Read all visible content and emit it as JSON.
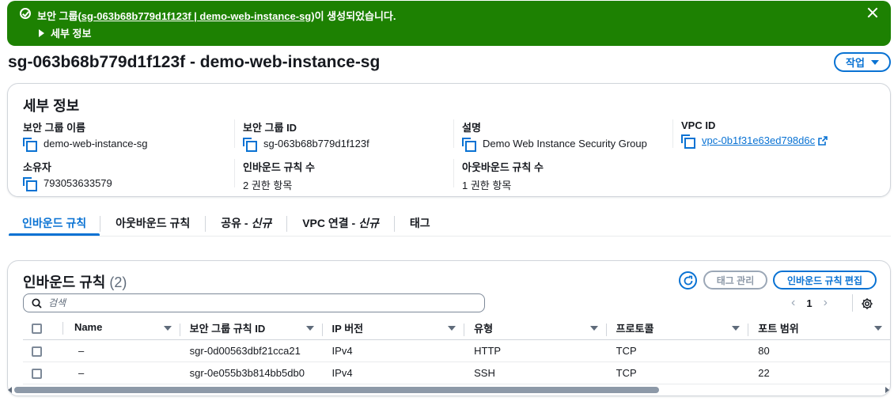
{
  "flash": {
    "message_prefix": "보안 그룹(",
    "message_link": "sg-063b68b779d1f123f | demo-web-instance-sg",
    "message_suffix": ")이 생성되었습니다.",
    "details_label": "세부 정보",
    "icon": "success-check-icon",
    "color": "#1d8102"
  },
  "page": {
    "title": "sg-063b68b779d1f123f - demo-web-instance-sg",
    "actions_label": "작업"
  },
  "details": {
    "title": "세부 정보",
    "fields": [
      {
        "label": "보안 그룹 이름",
        "value": "demo-web-instance-sg"
      },
      {
        "label": "보안 그룹 ID",
        "value": "sg-063b68b779d1f123f"
      },
      {
        "label": "설명",
        "value": "Demo Web Instance Security Group"
      },
      {
        "label": "VPC ID",
        "value": "vpc-0b1f31e63ed798d6c"
      },
      {
        "label": "소유자",
        "value": "793053633579"
      },
      {
        "label": "인바운드 규칙 수",
        "value": "2 권한 항목"
      },
      {
        "label": "아웃바운드 규칙 수",
        "value": "1 권한 항목"
      }
    ]
  },
  "tabs": [
    {
      "label": "인바운드 규칙",
      "new": ""
    },
    {
      "label": "아웃바운드 규칙",
      "new": ""
    },
    {
      "label": "공유 -",
      "new": "신규"
    },
    {
      "label": "VPC 연결 -",
      "new": "신규"
    },
    {
      "label": "태그",
      "new": ""
    }
  ],
  "rules": {
    "title": "인바운드 규칙",
    "count": "(2)",
    "manage_tags_label": "태그 관리",
    "edit_label": "인바운드 규칙 편집",
    "search_placeholder": "검색",
    "page_number": "1",
    "columns": [
      "Name",
      "보안 그룹 규칙 ID",
      "IP 버전",
      "유형",
      "프로토콜",
      "포트 범위"
    ],
    "rows": [
      [
        "–",
        "sgr-0d00563dbf21cca21",
        "IPv4",
        "HTTP",
        "TCP",
        "80"
      ],
      [
        "–",
        "sgr-0e055b3b814bb5db0",
        "IPv4",
        "SSH",
        "TCP",
        "22"
      ]
    ]
  },
  "colors": {
    "accent": "#0972d3",
    "success": "#1d8102"
  }
}
